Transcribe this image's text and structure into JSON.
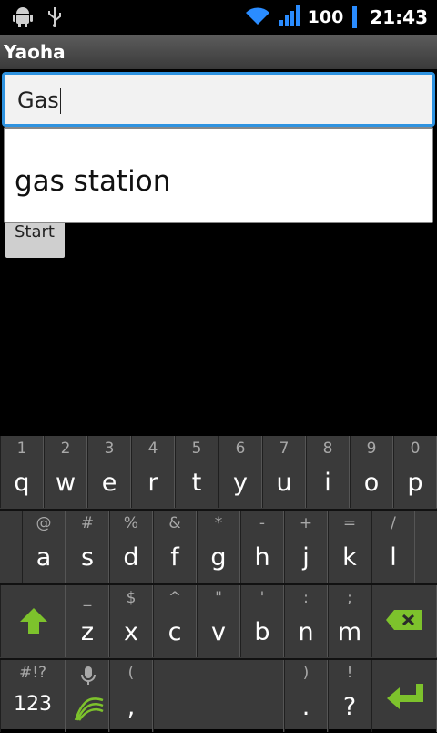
{
  "status": {
    "battery": "100",
    "time": "21:43"
  },
  "app": {
    "title": "Yaoha"
  },
  "search": {
    "value": "Gas"
  },
  "suggestion": "gas station",
  "start_label": "Start",
  "keyboard": {
    "row1": [
      {
        "hint": "1",
        "key": "q"
      },
      {
        "hint": "2",
        "key": "w"
      },
      {
        "hint": "3",
        "key": "e"
      },
      {
        "hint": "4",
        "key": "r"
      },
      {
        "hint": "5",
        "key": "t"
      },
      {
        "hint": "6",
        "key": "y"
      },
      {
        "hint": "7",
        "key": "u"
      },
      {
        "hint": "8",
        "key": "i"
      },
      {
        "hint": "9",
        "key": "o"
      },
      {
        "hint": "0",
        "key": "p"
      }
    ],
    "row2": [
      {
        "hint": "@",
        "key": "a"
      },
      {
        "hint": "#",
        "key": "s"
      },
      {
        "hint": "%",
        "key": "d"
      },
      {
        "hint": "&",
        "key": "f"
      },
      {
        "hint": "*",
        "key": "g"
      },
      {
        "hint": "-",
        "key": "h"
      },
      {
        "hint": "+",
        "key": "j"
      },
      {
        "hint": "=",
        "key": "k"
      },
      {
        "hint": "/",
        "key": "l"
      }
    ],
    "row3": [
      {
        "hint": "_",
        "key": "z"
      },
      {
        "hint": "$",
        "key": "x"
      },
      {
        "hint": "^",
        "key": "c"
      },
      {
        "hint": "\"",
        "key": "v"
      },
      {
        "hint": "'",
        "key": "b"
      },
      {
        "hint": ":",
        "key": "n"
      },
      {
        "hint": ";",
        "key": "m"
      }
    ],
    "row4": {
      "sym_hint": "#!?",
      "sym_label": "123",
      "comma_hint": "(",
      "comma": ",",
      "period_hint": ")",
      "period": ".",
      "question_hint": "!",
      "question": "?"
    }
  }
}
